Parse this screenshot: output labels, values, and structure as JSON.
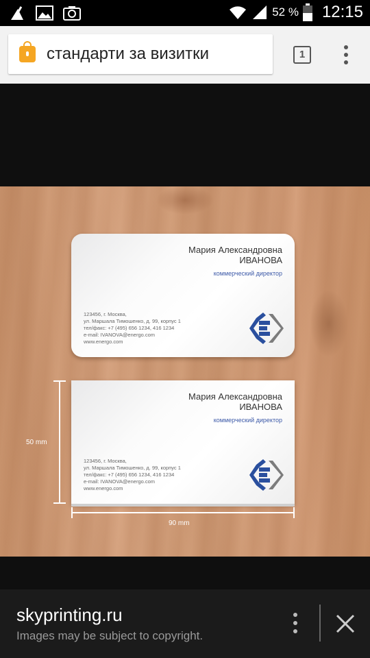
{
  "status_bar": {
    "battery_percent": "52 %",
    "time": "12:15"
  },
  "browser": {
    "search_query": "стандарти за визитки",
    "tab_count": "1"
  },
  "image": {
    "card_top": {
      "name_line1": "Мария Александровна",
      "name_line2": "ИВАНОВА",
      "position": "коммерческий директор",
      "address_lines": [
        "123456, г. Москва,",
        "ул. Маршала Тимошенко, д. 99, корпус 1",
        "тел/факс: +7 (495) 656 1234, 416 1234",
        "e-mail: IVANOVA@energo.com",
        "www.energo.com"
      ]
    },
    "card_bottom": {
      "name_line1": "Мария Александровна",
      "name_line2": "ИВАНОВА",
      "position": "коммерческий директор",
      "address_lines": [
        "123456, г. Москва,",
        "ул. Маршала Тимошенко, д. 99, корпус 1",
        "тел/факс: +7 (495) 656 1234, 416 1234",
        "e-mail: IVANOVA@energo.com",
        "www.energo.com"
      ]
    },
    "height_label": "50 mm",
    "width_label": "90 mm",
    "logo_colors": {
      "blue": "#2a4f9e",
      "gray": "#7c7c7c"
    }
  },
  "info_bar": {
    "site": "skyprinting.ru",
    "copyright_notice": "Images may be subject to copyright."
  },
  "colors": {
    "lock_icon": "#f5a623",
    "card_title": "#3d5aa8"
  }
}
